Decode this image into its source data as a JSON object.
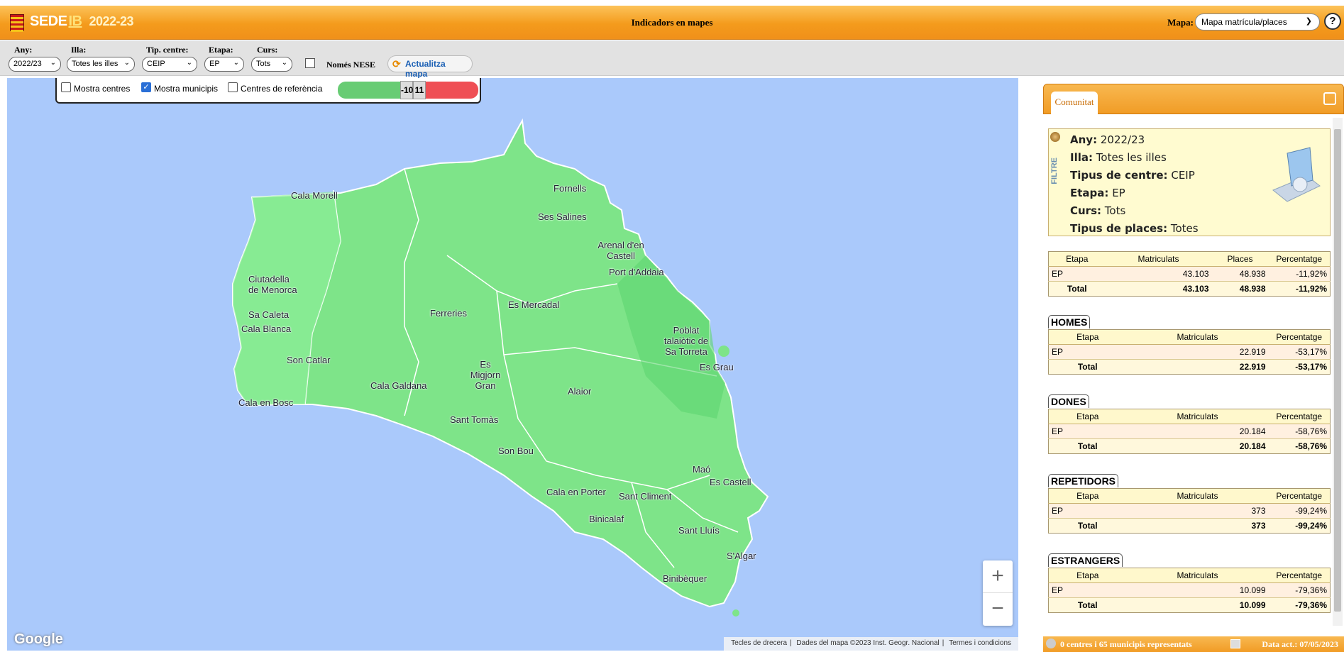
{
  "header": {
    "brand": "SEDE",
    "brand_ib": "IB",
    "year": "2022-23",
    "title": "Indicadors en mapes",
    "map_label": "Mapa:",
    "map_select": "Mapa matrícula/places",
    "help": "?"
  },
  "filters": {
    "any": {
      "label": "Any:",
      "value": "2022/23"
    },
    "illa": {
      "label": "Illa:",
      "value": "Totes les illes"
    },
    "tip": {
      "label": "Tip. centre:",
      "value": "CEIP"
    },
    "etapa": {
      "label": "Etapa:",
      "value": "EP"
    },
    "curs": {
      "label": "Curs:",
      "value": "Tots"
    },
    "nese": "Només NESE",
    "refresh": "Actualitza mapa"
  },
  "map_controls": {
    "show_centres": "Mostra centres",
    "show_municipis": "Mostra municipis",
    "ref_centres": "Centres de referència",
    "scale_min": "-10",
    "scale_max": "11"
  },
  "map": {
    "places": [
      "Cala Morell",
      "Fornells",
      "Ses Salines",
      "Arenal d'en Castell",
      "Port d'Addaia",
      "Ciutadella de Menorca",
      "Ferreries",
      "Es Mercadal",
      "Sa Caleta",
      "Cala Blanca",
      "Son Catlar",
      "Poblat talaiòtic de Sa Torreta",
      "Es Migjorn Gran",
      "Es Grau",
      "Cala Galdana",
      "Alaior",
      "Cala en Bosc",
      "Sant Tomàs",
      "Son Bou",
      "Maó",
      "Es Castell",
      "Cala en Porter",
      "Sant Climent",
      "Binicalaf",
      "Sant Lluís",
      "S'Algar",
      "Binibèquer"
    ],
    "google": "Google",
    "attribution": [
      "Tecles de drecera",
      "Dades del mapa ©2023 Inst. Geogr. Nacional",
      "Termes i condicions"
    ]
  },
  "panel": {
    "tab": "Comunitat",
    "filter_word": "FILTRE",
    "filter": [
      {
        "k": "Any:",
        "v": "2022/23"
      },
      {
        "k": "Illa:",
        "v": "Totes les illes"
      },
      {
        "k": "Tipus de centre:",
        "v": "CEIP"
      },
      {
        "k": "Etapa:",
        "v": "EP"
      },
      {
        "k": "Curs:",
        "v": "Tots"
      },
      {
        "k": "Tipus de places:",
        "v": "Totes"
      }
    ],
    "main": {
      "h": [
        "Etapa",
        "Matriculats",
        "Places",
        "Percentatge"
      ],
      "row": [
        "EP",
        "43.103",
        "48.938",
        "-11,92%"
      ],
      "total": [
        "Total",
        "43.103",
        "48.938",
        "-11,92%"
      ]
    },
    "sections": [
      {
        "title": "HOMES",
        "h": [
          "Etapa",
          "Matriculats",
          "Percentatge"
        ],
        "row": [
          "EP",
          "22.919",
          "-53,17%"
        ],
        "total": [
          "Total",
          "22.919",
          "-53,17%"
        ]
      },
      {
        "title": "DONES",
        "h": [
          "Etapa",
          "Matriculats",
          "Percentatge"
        ],
        "row": [
          "EP",
          "20.184",
          "-58,76%"
        ],
        "total": [
          "Total",
          "20.184",
          "-58,76%"
        ]
      },
      {
        "title": "REPETIDORS",
        "h": [
          "Etapa",
          "Matriculats",
          "Percentatge"
        ],
        "row": [
          "EP",
          "373",
          "-99,24%"
        ],
        "total": [
          "Total",
          "373",
          "-99,24%"
        ]
      },
      {
        "title": "ESTRANGERS",
        "h": [
          "Etapa",
          "Matriculats",
          "Percentatge"
        ],
        "row": [
          "EP",
          "10.099",
          "-79,36%"
        ],
        "total": [
          "Total",
          "10.099",
          "-79,36%"
        ]
      }
    ],
    "footer_left": "0 centres i 65 municipis representats",
    "footer_right": "Data act.: 07/05/2023"
  }
}
